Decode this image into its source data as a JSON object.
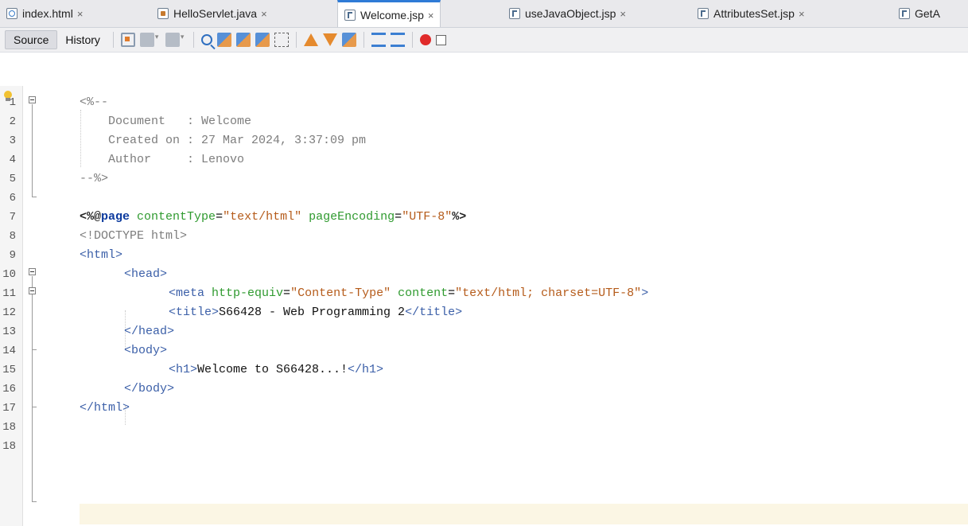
{
  "tabs": [
    {
      "label": "index.html",
      "icon": "html-file-icon",
      "close": "×"
    },
    {
      "label": "HelloServlet.java",
      "icon": "java-file-icon",
      "close": "×"
    },
    {
      "label": "Welcome.jsp",
      "icon": "jsp-file-icon",
      "close": "×",
      "active": true
    },
    {
      "label": "useJavaObject.jsp",
      "icon": "jsp-file-icon",
      "close": "×"
    },
    {
      "label": "AttributesSet.jsp",
      "icon": "jsp-file-icon",
      "close": "×"
    },
    {
      "label": "GetA",
      "icon": "jsp-file-icon"
    }
  ],
  "toolbar": {
    "source_label": "Source",
    "history_label": "History"
  },
  "line_numbers": [
    "1",
    "2",
    "3",
    "4",
    "5",
    "6",
    "7",
    "8",
    "9",
    "10",
    "11",
    "12",
    "13",
    "14",
    "15",
    "16",
    "17",
    "18"
  ],
  "code": {
    "l1": "<%--",
    "l2": "    Document   : Welcome",
    "l3": "    Created on : 27 Mar 2024, 3:37:09 pm",
    "l4": "    Author     : Lenovo",
    "l5": "--%>",
    "l7_open": "<%@",
    "l7_name": "page",
    "l7_a1": "contentType",
    "l7_v1": "\"text/html\"",
    "l7_a2": "pageEncoding",
    "l7_v2": "\"UTF-8\"",
    "l7_close": "%>",
    "l8": "<!DOCTYPE html>",
    "l9": "<html>",
    "l10": "<head>",
    "l11_open": "<meta",
    "l11_a1": "http-equiv",
    "l11_v1": "\"Content-Type\"",
    "l11_a2": "content",
    "l11_v2": "\"text/html; charset=UTF-8\"",
    "l11_close": ">",
    "l12_open": "<title>",
    "l12_text": "S66428 - Web Programming 2",
    "l12_close": "</title>",
    "l13": "</head>",
    "l14": "<body>",
    "l15_open": "<h1>",
    "l15_text": "Welcome to S66428...!",
    "l15_close": "</h1>",
    "l16": "</body>",
    "l17": "</html>"
  },
  "colors": {
    "comment": "#7d7d7d",
    "tag": "#3b5fa8",
    "attribute": "#2f9a2f",
    "string": "#b55b1a",
    "active_tab_accent": "#2f7bd6",
    "current_line": "#fbf6e4"
  }
}
